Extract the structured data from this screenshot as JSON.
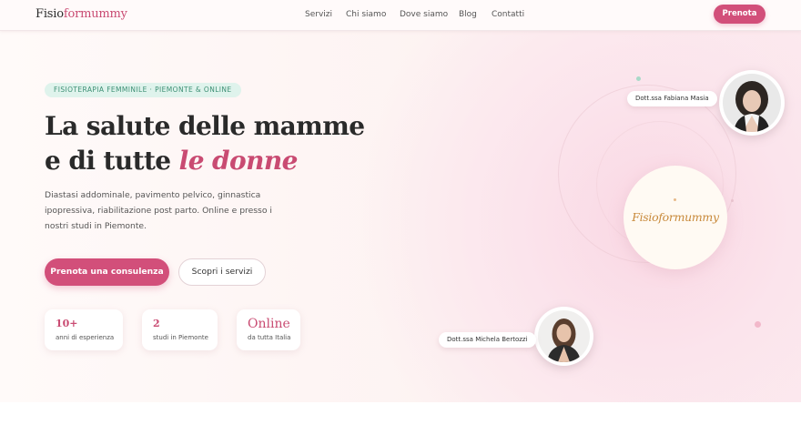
{
  "header": {
    "logo_part1": "Fisio",
    "logo_part2": "formummy",
    "nav": [
      "Servizi",
      "Chi siamo",
      "Dove siamo",
      "Blog",
      "Contatti"
    ],
    "cta_label": "Prenota"
  },
  "hero": {
    "tag": "FISIOTERAPIA FEMMINILE · PIEMONTE & ONLINE",
    "headline_line1": "La salute delle mamme",
    "headline_line2_plain": "e di tutte ",
    "headline_line2_accent": "le donne",
    "description": "Diastasi addominale, pavimento pelvico, ginnastica ipopressiva, riabilitazione post parto. Online e presso i nostri studi in Piemonte.",
    "primary_button": "Prenota una consulenza",
    "secondary_button": "Scopri i servizi",
    "stats": [
      {
        "value": "10+",
        "label": "anni di esperienza"
      },
      {
        "value": "2",
        "label": "studi in Piemonte"
      },
      {
        "value": "Online",
        "label": "da tutta Italia"
      }
    ]
  },
  "visual": {
    "brand": "Fisioformummy",
    "doctor1": "Dott.ssa Fabiana Masia",
    "doctor2": "Dott.ssa Michela Bertozzi"
  },
  "colors": {
    "accent": "#d24f7a",
    "tag_bg": "#dff3ec",
    "tag_text": "#3d8f74",
    "brand_gold": "#c8893a"
  },
  "icons": [
    "doctor-photo-fabiana",
    "doctor-photo-michela"
  ]
}
